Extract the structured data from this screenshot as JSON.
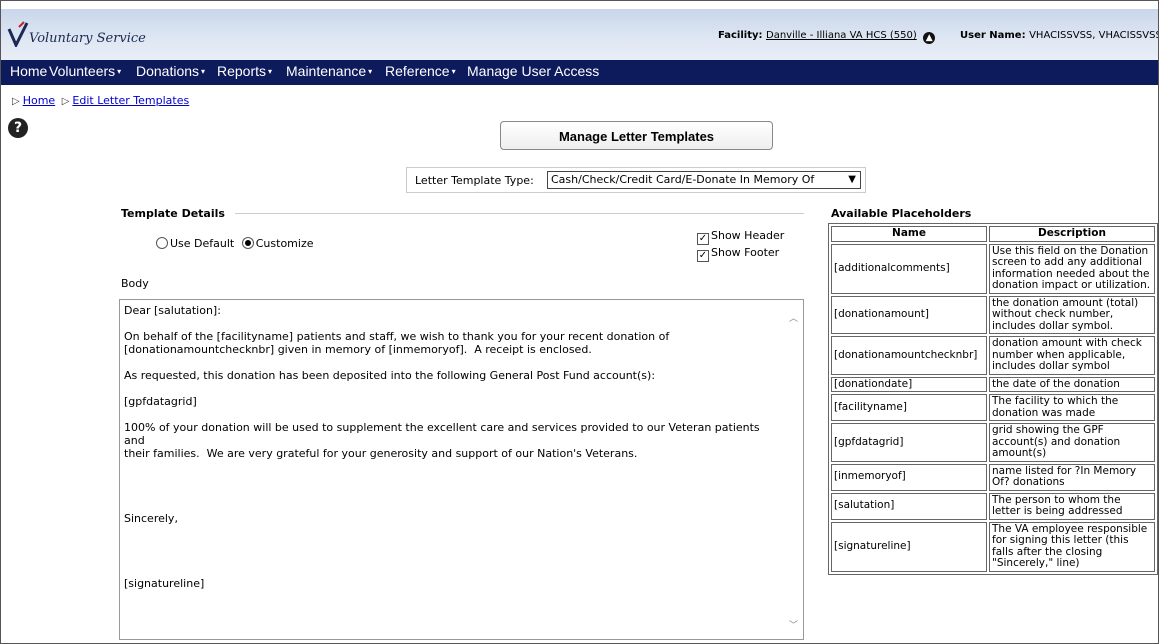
{
  "app": {
    "name": "Voluntary Service"
  },
  "header": {
    "facility_label": "Facility:",
    "facility_value": "Danville - Illiana VA HCS (550)",
    "user_label": "User Name:",
    "user_value": "VHACISSVSS, VHACISSVSS"
  },
  "nav": {
    "items": [
      {
        "label": "Home"
      },
      {
        "label": "Volunteers"
      },
      {
        "label": "Donations"
      },
      {
        "label": "Reports"
      },
      {
        "label": "Maintenance"
      },
      {
        "label": "Reference"
      },
      {
        "label": "Manage User Access"
      }
    ],
    "caret": "▾"
  },
  "breadcrumb": {
    "home": "Home",
    "current": "Edit Letter Templates"
  },
  "help": {
    "glyph": "?"
  },
  "page": {
    "title_button": "Manage Letter Templates"
  },
  "template_type": {
    "label": "Letter Template Type:",
    "selected": "Cash/Check/Credit Card/E-Donate In Memory Of"
  },
  "details": {
    "title": "Template Details",
    "use_default": "Use Default",
    "customize": "Customize",
    "selected_mode": "Customize",
    "show_header": "Show Header",
    "show_footer": "Show Footer",
    "show_header_checked": true,
    "show_footer_checked": true,
    "body_label": "Body",
    "body_lines": [
      "Dear [salutation]:",
      "",
      "On behalf of the [facilityname] patients and staff, we wish to thank you for your recent donation of",
      "[donationamountchecknbr] given in memory of [inmemoryof].  A receipt is enclosed.",
      "",
      "As requested, this donation has been deposited into the following General Post Fund account(s):",
      "",
      "[gpfdatagrid]",
      "",
      "100% of your donation will be used to supplement the excellent care and services provided to our Veteran patients and",
      "their families.  We are very grateful for your generosity and support of our Nation's Veterans.",
      "",
      "",
      "",
      "",
      "Sincerely,",
      "",
      "",
      "",
      "",
      "[signatureline]"
    ]
  },
  "placeholders": {
    "title": "Available Placeholders",
    "col_name": "Name",
    "col_desc": "Description",
    "rows": [
      {
        "name": "[additionalcomments]",
        "desc": "Use this field on the Donation screen to add any additional information needed about the donation impact or utilization."
      },
      {
        "name": "[donationamount]",
        "desc": "the donation amount (total) without check number, includes dollar symbol."
      },
      {
        "name": "[donationamountchecknbr]",
        "desc": "donation amount with check number when applicable, includes dollar symbol"
      },
      {
        "name": "[donationdate]",
        "desc": "the date of the donation"
      },
      {
        "name": "[facilityname]",
        "desc": "The facility to which the donation was made"
      },
      {
        "name": "[gpfdatagrid]",
        "desc": "grid showing the GPF account(s) and donation amount(s)"
      },
      {
        "name": "[inmemoryof]",
        "desc": "name listed for ?In Memory Of? donations"
      },
      {
        "name": "[salutation]",
        "desc": "The person to whom the letter is being addressed"
      },
      {
        "name": "[signatureline]",
        "desc": "The VA employee responsible for signing this letter (this falls after the closing \"Sincerely,\" line)"
      }
    ]
  },
  "icons": {
    "logo": "va-logo-icon",
    "facility_change": "arrow-up-circle-icon",
    "help": "help-icon",
    "dropdown": "chevron-down-icon"
  },
  "colors": {
    "nav_bg": "#0d1a5c",
    "header_bg": "#c9d6ea",
    "link": "#0000cc"
  }
}
